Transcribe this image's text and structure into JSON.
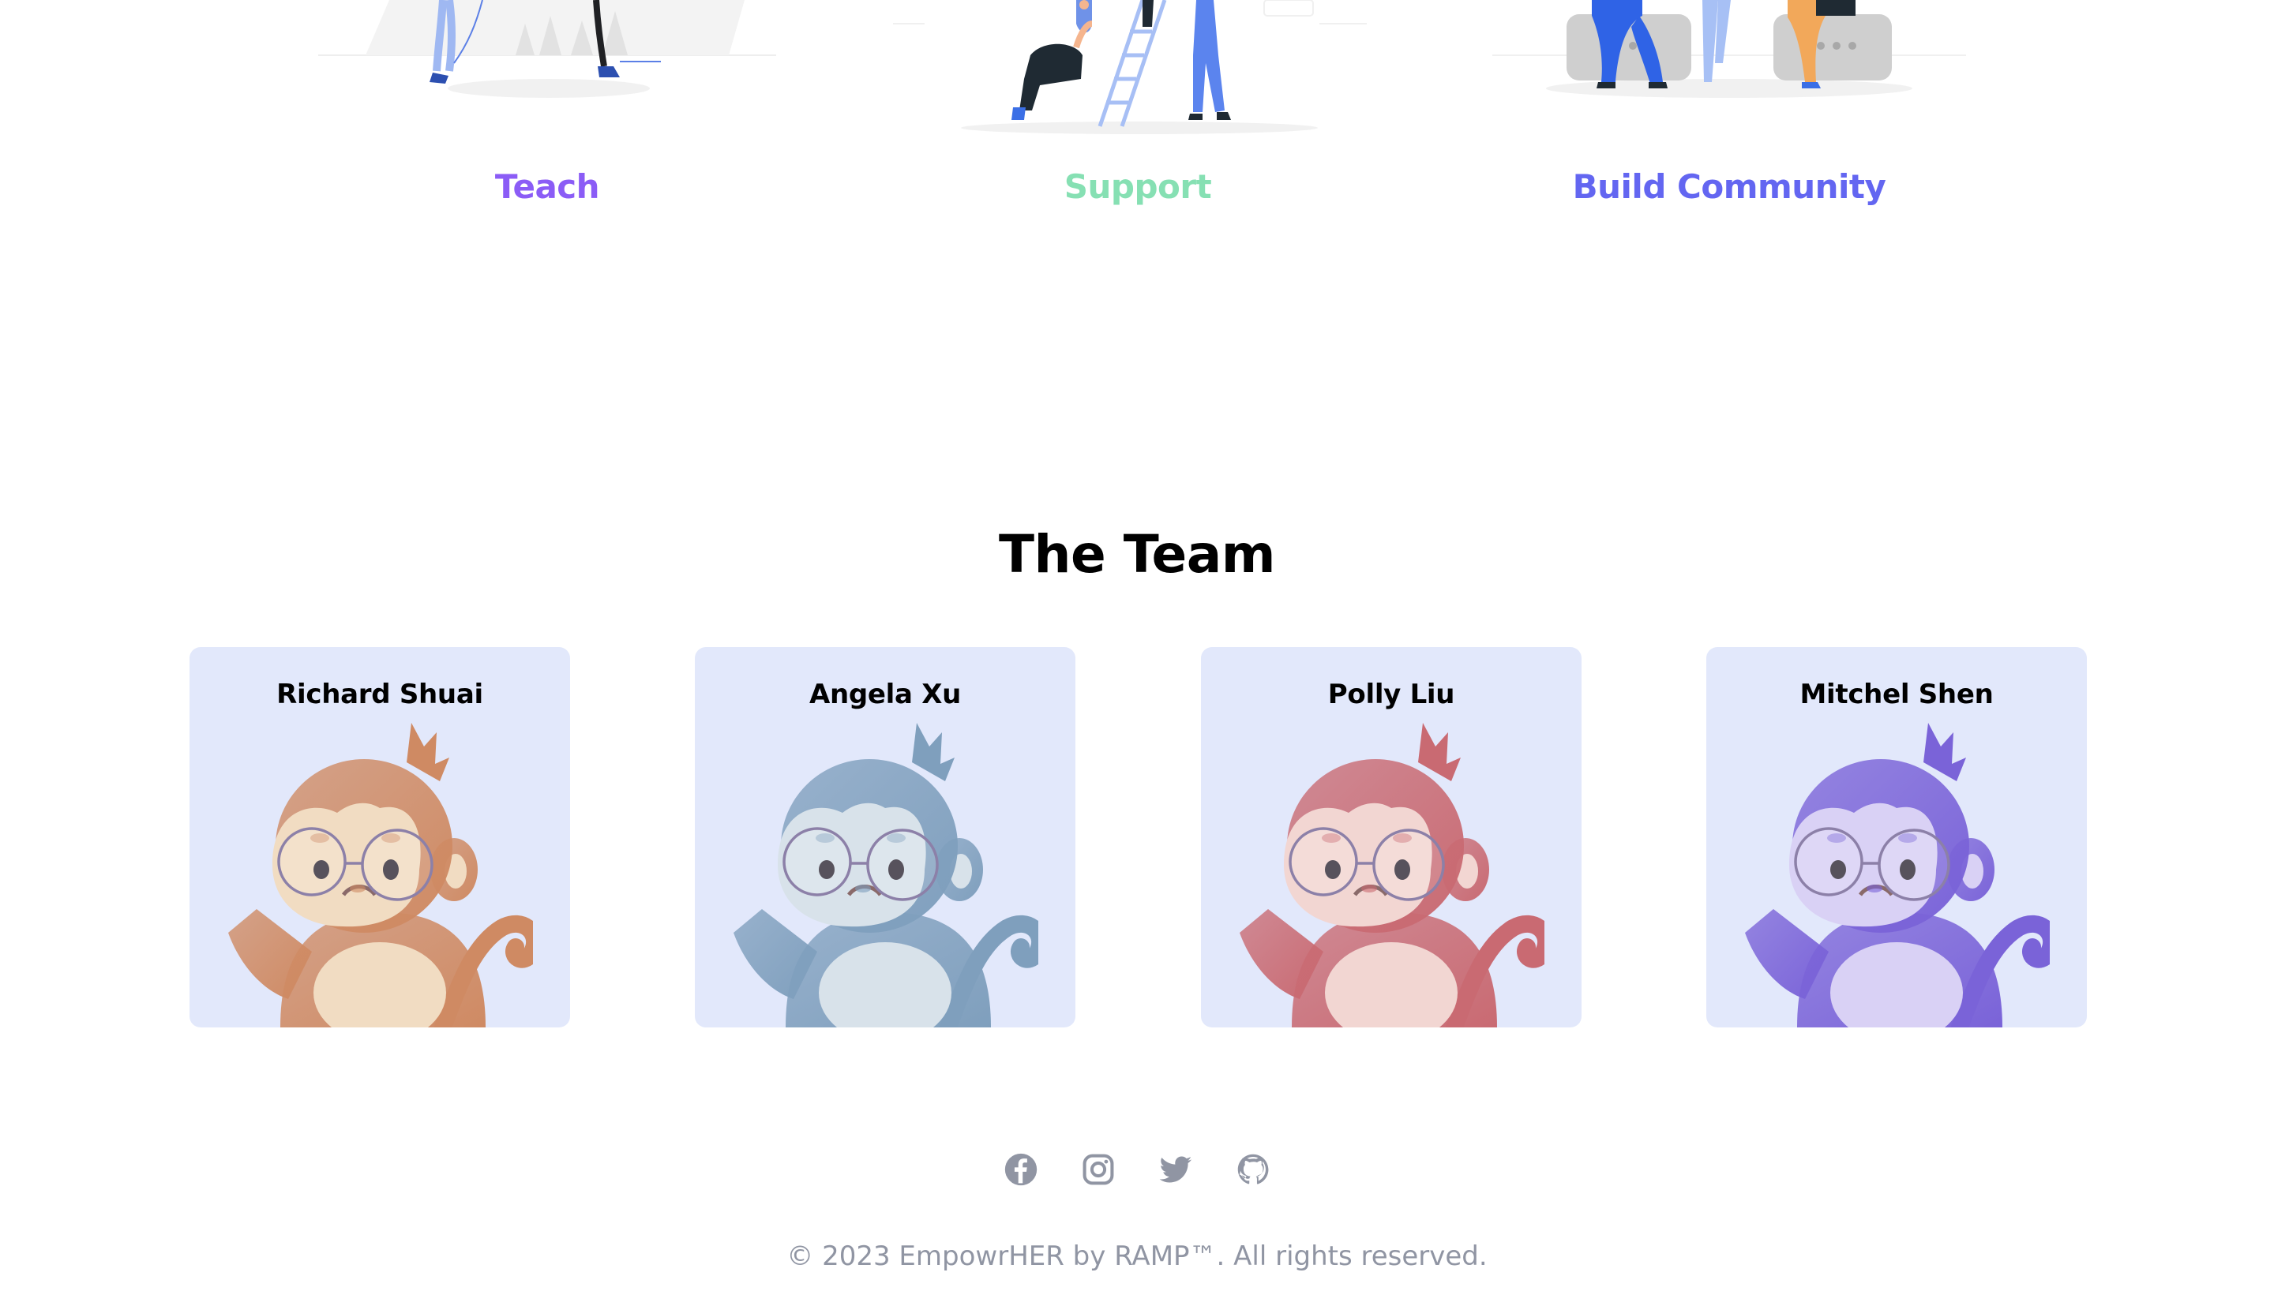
{
  "features": [
    {
      "title": "Teach",
      "color": "#8b5cf6"
    },
    {
      "title": "Support",
      "color": "#86e0b3"
    },
    {
      "title": "Build Community",
      "color": "#6366f1"
    }
  ],
  "team": {
    "heading": "The Team",
    "card_bg": "#e2e8fb",
    "members": [
      {
        "name": "Richard Shuai",
        "avatar": "monkey-avatar-orange",
        "color": "#cf8a63",
        "light": "#f1dcc2"
      },
      {
        "name": "Angela Xu",
        "avatar": "monkey-avatar-blue",
        "color": "#7f9fbd",
        "light": "#d8e2ea"
      },
      {
        "name": "Polly Liu",
        "avatar": "monkey-avatar-red",
        "color": "#c96a72",
        "light": "#f2d6d2"
      },
      {
        "name": "Mitchel Shen",
        "avatar": "monkey-avatar-purple",
        "color": "#7a63d8",
        "light": "#d9d1f5"
      }
    ]
  },
  "footer": {
    "socials": [
      {
        "name": "facebook",
        "icon": "facebook-icon"
      },
      {
        "name": "instagram",
        "icon": "instagram-icon"
      },
      {
        "name": "twitter",
        "icon": "twitter-icon"
      },
      {
        "name": "github",
        "icon": "github-icon"
      }
    ],
    "icon_color": "#9095a3",
    "copyright": "© 2023 EmpowrHER by RAMP™. All rights reserved."
  }
}
